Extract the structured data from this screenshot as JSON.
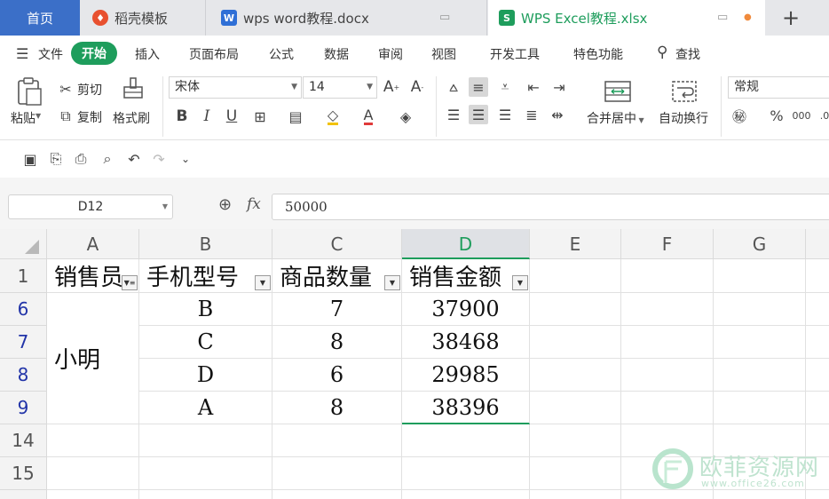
{
  "tabs": {
    "home": "首页",
    "doc1": "稻壳模板",
    "doc2": "wps word教程.docx",
    "doc3": "WPS Excel教程.xlsx",
    "add": "+"
  },
  "menu": [
    "文件",
    "开始",
    "插入",
    "页面布局",
    "公式",
    "数据",
    "审阅",
    "视图",
    "开发工具",
    "特色功能",
    "查找"
  ],
  "ribbon": {
    "paste": "粘贴",
    "cut": "剪切",
    "copy": "复制",
    "format_painter": "格式刷",
    "font_name": "宋体",
    "font_size": "14",
    "merge_center": "合并居中",
    "wrap_text": "自动换行",
    "number_format": "常规"
  },
  "formula_bar": {
    "name_box": "D12",
    "fx": "fx",
    "value": "50000"
  },
  "columns": [
    "A",
    "B",
    "C",
    "D",
    "E",
    "F",
    "G"
  ],
  "rows": [
    {
      "num": "1"
    },
    {
      "num": "6"
    },
    {
      "num": "7"
    },
    {
      "num": "8"
    },
    {
      "num": "9"
    },
    {
      "num": "14"
    },
    {
      "num": "15"
    }
  ],
  "sheet": {
    "headers": [
      "销售员",
      "手机型号",
      "商品数量",
      "销售金额"
    ],
    "merged_a": "小明",
    "data": [
      {
        "model": "B",
        "qty": "7",
        "amount": "37900"
      },
      {
        "model": "C",
        "qty": "8",
        "amount": "38468"
      },
      {
        "model": "D",
        "qty": "6",
        "amount": "29985"
      },
      {
        "model": "A",
        "qty": "8",
        "amount": "38396"
      }
    ]
  },
  "watermark": {
    "text": "欧菲资源网",
    "url": "www.office26.com"
  },
  "colors": {
    "accent": "#1e9d5c",
    "home_tab": "#3b6fc8",
    "filtered_row": "#2234a8"
  }
}
